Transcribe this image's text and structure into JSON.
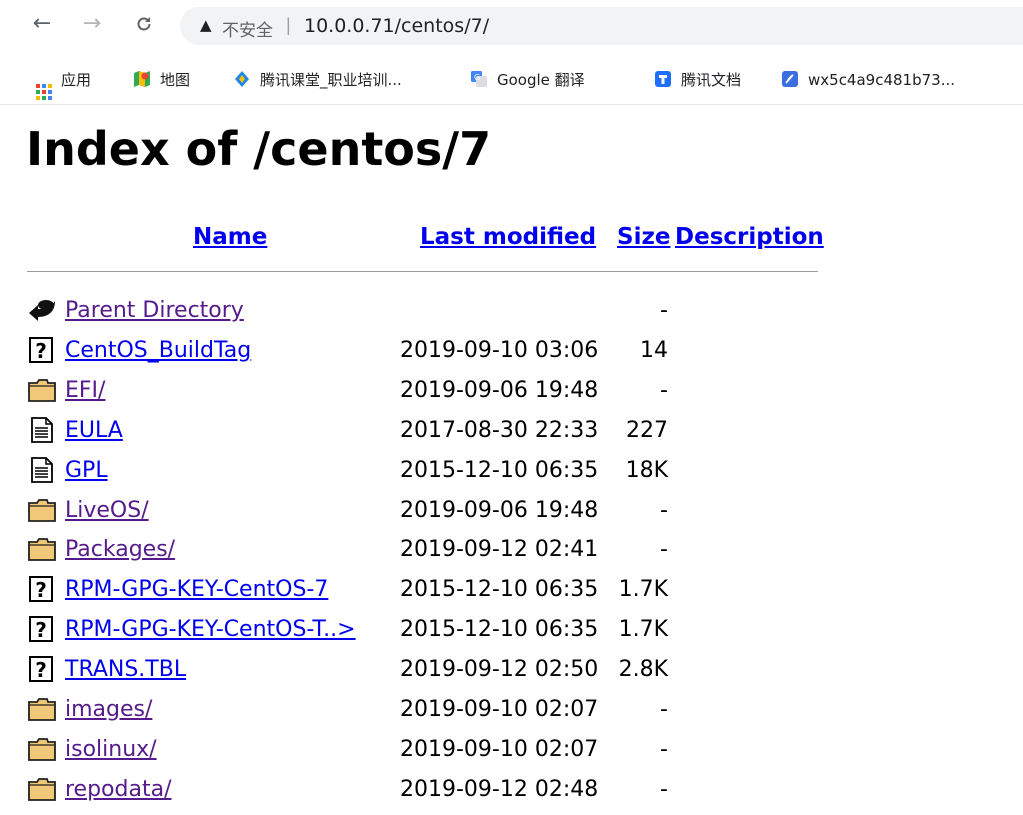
{
  "browser": {
    "back_icon": "←",
    "forward_icon": "→",
    "reload_icon": "C",
    "security_icon": "▲",
    "security_label": "不安全",
    "separator": "|",
    "url": "10.0.0.71/centos/7/"
  },
  "bookmarks": [
    {
      "label": "应用",
      "icon": "apps-grid-icon"
    },
    {
      "label": "地图",
      "icon": "maps-pin-icon"
    },
    {
      "label": "腾讯课堂_职业培训...",
      "icon": "tencent-classroom-icon"
    },
    {
      "label": "Google 翻译",
      "icon": "google-translate-icon"
    },
    {
      "label": "腾讯文档",
      "icon": "tencent-docs-icon"
    },
    {
      "label": "wx5c4a9c481b73...",
      "icon": "feather-icon"
    }
  ],
  "page": {
    "title": "Index of /centos/7"
  },
  "table": {
    "headers": {
      "name": "Name",
      "last_modified": "Last modified",
      "size": "Size",
      "description": "Description"
    },
    "rows": [
      {
        "name": "Parent Directory",
        "date": "",
        "size": "-",
        "type": "back",
        "visited": true
      },
      {
        "name": "CentOS_BuildTag",
        "date": "2019-09-10 03:06",
        "size": "14",
        "type": "unknown",
        "visited": false
      },
      {
        "name": "EFI/",
        "date": "2019-09-06 19:48",
        "size": "-",
        "type": "folder",
        "visited": true
      },
      {
        "name": "EULA",
        "date": "2017-08-30 22:33",
        "size": "227",
        "type": "text",
        "visited": false
      },
      {
        "name": "GPL",
        "date": "2015-12-10 06:35",
        "size": "18K",
        "type": "text",
        "visited": false
      },
      {
        "name": "LiveOS/",
        "date": "2019-09-06 19:48",
        "size": "-",
        "type": "folder",
        "visited": true
      },
      {
        "name": "Packages/",
        "date": "2019-09-12 02:41",
        "size": "-",
        "type": "folder",
        "visited": true
      },
      {
        "name": "RPM-GPG-KEY-CentOS-7",
        "date": "2015-12-10 06:35",
        "size": "1.7K",
        "type": "unknown",
        "visited": false
      },
      {
        "name": "RPM-GPG-KEY-CentOS-T..>",
        "date": "2015-12-10 06:35",
        "size": "1.7K",
        "type": "unknown",
        "visited": false
      },
      {
        "name": "TRANS.TBL",
        "date": "2019-09-12 02:50",
        "size": "2.8K",
        "type": "unknown",
        "visited": false
      },
      {
        "name": "images/",
        "date": "2019-09-10 02:07",
        "size": "-",
        "type": "folder",
        "visited": true
      },
      {
        "name": "isolinux/",
        "date": "2019-09-10 02:07",
        "size": "-",
        "type": "folder",
        "visited": true
      },
      {
        "name": "repodata/",
        "date": "2019-09-12 02:48",
        "size": "-",
        "type": "folder",
        "visited": true
      }
    ]
  },
  "colors": {
    "link": "#0000ee",
    "visited": "#551a8b",
    "folder": "#f0c878"
  }
}
